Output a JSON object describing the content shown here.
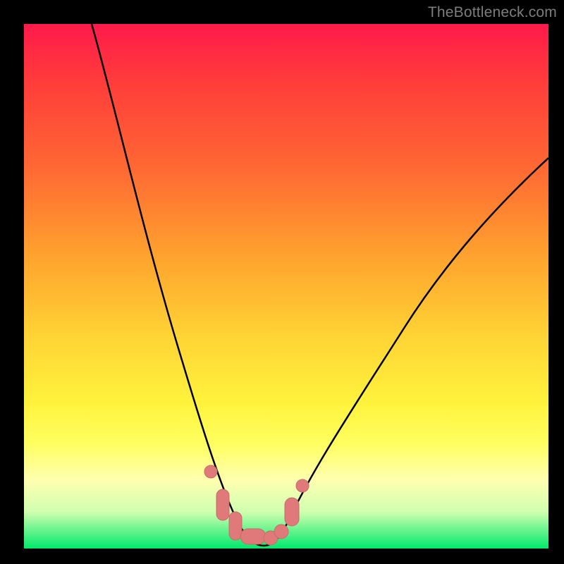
{
  "watermark": {
    "text": "TheBottleneck.com"
  },
  "colors": {
    "frame": "#000000",
    "curve_stroke": "#000000",
    "marker_fill": "#e07a7a",
    "marker_stroke": "#c96b6b"
  },
  "chart_data": {
    "type": "line",
    "title": "",
    "xlabel": "",
    "ylabel": "",
    "xlim": [
      0,
      100
    ],
    "ylim": [
      0,
      100
    ],
    "grid": false,
    "series": [
      {
        "name": "bottleneck-curve",
        "x": [
          13,
          15,
          18,
          21,
          24,
          27,
          30,
          32,
          34,
          36,
          37.5,
          39,
          40.5,
          42,
          43.5,
          45,
          47,
          49,
          52,
          55,
          58,
          62,
          66,
          70,
          75,
          80,
          85,
          90,
          95,
          100
        ],
        "y": [
          100,
          90,
          78,
          66,
          55,
          45,
          36,
          29,
          22,
          16,
          12,
          8,
          5,
          3,
          2,
          2,
          3,
          5,
          9,
          14,
          20,
          27,
          34,
          41,
          48,
          55,
          61,
          66,
          71,
          75
        ]
      }
    ],
    "annotations": {
      "trough_markers": {
        "comment": "pink rounded markers emphasizing the basin of the curve",
        "x": [
          35.5,
          37,
          38.5,
          40,
          41.5,
          43,
          44.5,
          46,
          48,
          49.5,
          51
        ],
        "y": [
          15,
          10,
          6,
          3.5,
          2.5,
          2.5,
          2.5,
          3,
          6,
          9,
          13
        ]
      }
    }
  }
}
